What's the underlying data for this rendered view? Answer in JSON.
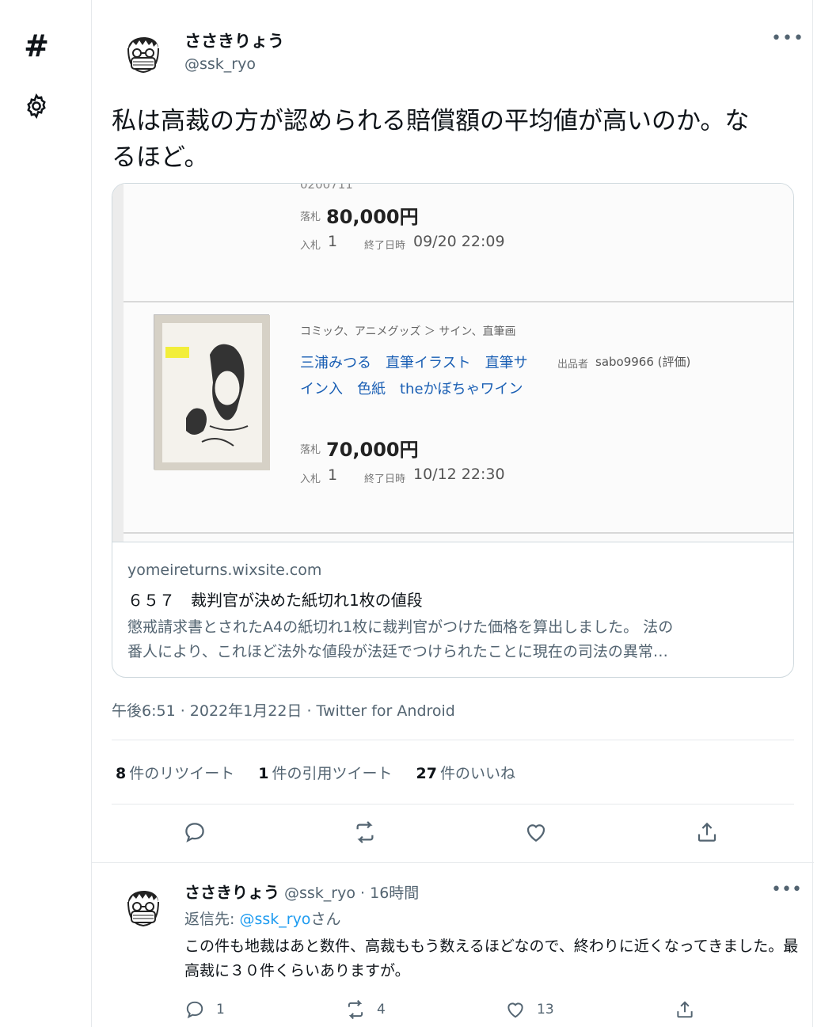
{
  "nav": {
    "hash_icon": "hash-icon",
    "gear_icon": "gear-icon"
  },
  "tweet": {
    "display_name": "ささきりょう",
    "handle": "@ssk_ryo",
    "more": "•••",
    "text": "私は高裁の方が認められる賠償額の平均値が高いのか。なるほど。",
    "card": {
      "image": {
        "top_cut_text": "0200711",
        "item1_label_price": "落札",
        "item1_price": "80,000円",
        "item1_bids_label": "入札",
        "item1_bids": "1",
        "item1_end_label": "終了日時",
        "item1_end": "09/20 22:09",
        "item2_breadcrumb": "コミック、アニメグッズ ＞ サイン、直筆画",
        "item2_title": "三浦みつる　直筆イラスト　直筆サイン入　色紙　theかぼちゃワイン",
        "item2_seller_label": "出品者",
        "item2_seller": "sabo9966 (評価)",
        "item2_label_price": "落札",
        "item2_price": "70,000円",
        "item2_bids_label": "入札",
        "item2_bids": "1",
        "item2_end_label": "終了日時",
        "item2_end": "10/12 22:30"
      },
      "domain": "yomeireturns.wixsite.com",
      "title": "６５７　裁判官が決めた紙切れ1枚の値段",
      "desc_line1": "懲戒請求書とされたA4の紙切れ1枚に裁判官がつけた価格を算出しました。 法の",
      "desc_line2": "番人により、これほど法外な値段が法廷でつけられたことに現在の司法の異常…"
    },
    "timestamp": "午後6:51 · 2022年1月22日 · Twitter for Android",
    "stats": {
      "retweets_count": "8",
      "retweets_label": "件のリツイート",
      "quotes_count": "1",
      "quotes_label": "件の引用ツイート",
      "likes_count": "27",
      "likes_label": "件のいいね"
    }
  },
  "reply": {
    "display_name": "ささきりょう",
    "handle_time": "@ssk_ryo · 16時間",
    "reply_to_prefix": "返信先: ",
    "reply_to_mention": "@ssk_ryo",
    "reply_to_suffix": "さん",
    "text": "この件も地裁はあと数件、高裁ももう数えるほどなので、終わりに近くなってきました。最高裁に３０件くらいありますが。",
    "more": "•••",
    "reply_count": "1",
    "retweet_count": "4",
    "like_count": "13"
  }
}
